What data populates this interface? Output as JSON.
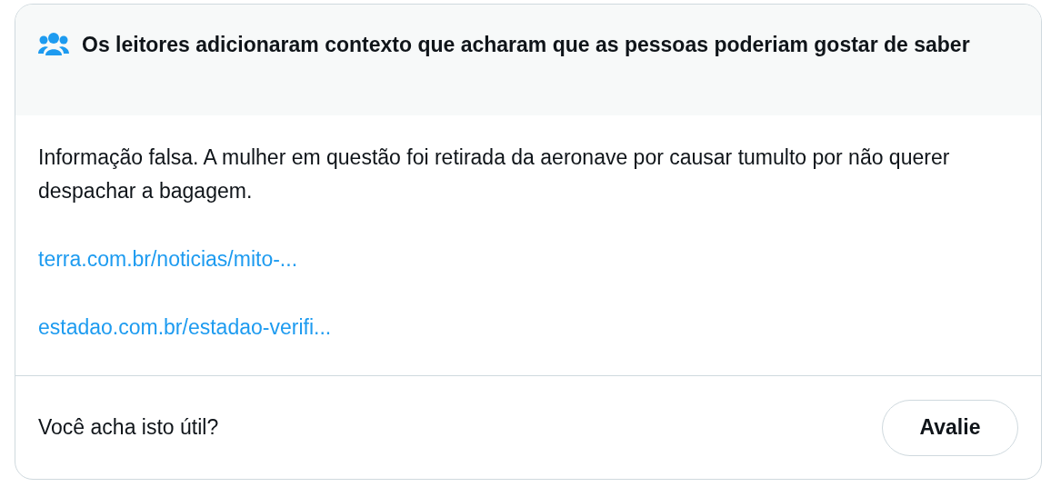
{
  "header": {
    "title": "Os leitores adicionaram contexto que acharam que as pessoas poderiam gostar de saber"
  },
  "note": {
    "text": "Informação falsa. A mulher em questão foi retirada da aeronave por causar tumulto por não querer despachar a bagagem."
  },
  "links": [
    "terra.com.br/noticias/mito-...",
    "estadao.com.br/estadao-verifi..."
  ],
  "footer": {
    "question": "Você acha isto útil?",
    "button": "Avalie"
  }
}
